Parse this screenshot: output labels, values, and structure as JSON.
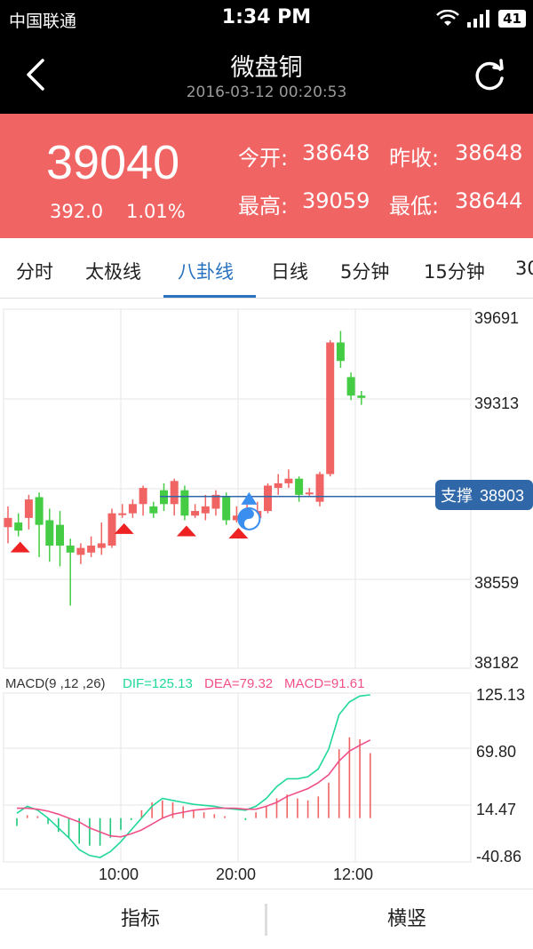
{
  "status": {
    "carrier": "中国联通",
    "time": "1:34 PM",
    "battery": "41"
  },
  "header": {
    "title": "微盘铜",
    "timestamp": "2016-03-12 00:20:53"
  },
  "quote": {
    "price": "39040",
    "change": "392.0",
    "change_pct": "1.01%",
    "open_label": "今开:",
    "open": "38648",
    "prev_close_label": "昨收:",
    "prev_close": "38648",
    "high_label": "最高:",
    "high": "39059",
    "low_label": "最低:",
    "low": "38644",
    "color": "#f06464"
  },
  "tabs": [
    {
      "label": "分时"
    },
    {
      "label": "太极线"
    },
    {
      "label": "八卦线",
      "active": true
    },
    {
      "label": "日线"
    },
    {
      "label": "5分钟"
    },
    {
      "label": "15分钟"
    },
    {
      "label": "30"
    }
  ],
  "chart_data": [
    {
      "type": "candlestick",
      "y_ticks": [
        "39691",
        "39313",
        "38559",
        "38182"
      ],
      "ylim": [
        38182,
        39691
      ],
      "support_label": "支撑",
      "support_value": "38903",
      "candles": [
        {
          "o": 38770,
          "c": 38810,
          "h": 38860,
          "l": 38700
        },
        {
          "o": 38790,
          "c": 38755,
          "h": 38830,
          "l": 38730
        },
        {
          "o": 38810,
          "c": 38890,
          "h": 38910,
          "l": 38760
        },
        {
          "o": 38900,
          "c": 38780,
          "h": 38920,
          "l": 38640
        },
        {
          "o": 38800,
          "c": 38690,
          "h": 38850,
          "l": 38620
        },
        {
          "o": 38780,
          "c": 38690,
          "h": 38840,
          "l": 38600
        },
        {
          "o": 38690,
          "c": 38660,
          "h": 38720,
          "l": 38430
        },
        {
          "o": 38650,
          "c": 38680,
          "h": 38700,
          "l": 38610
        },
        {
          "o": 38660,
          "c": 38690,
          "h": 38730,
          "l": 38640
        },
        {
          "o": 38680,
          "c": 38700,
          "h": 38790,
          "l": 38650
        },
        {
          "o": 38690,
          "c": 38830,
          "h": 38850,
          "l": 38680
        },
        {
          "o": 38830,
          "c": 38830,
          "h": 38870,
          "l": 38810
        },
        {
          "o": 38830,
          "c": 38870,
          "h": 38890,
          "l": 38810
        },
        {
          "o": 38870,
          "c": 38940,
          "h": 38950,
          "l": 38820
        },
        {
          "o": 38860,
          "c": 38830,
          "h": 38880,
          "l": 38810
        },
        {
          "o": 38930,
          "c": 38870,
          "h": 38960,
          "l": 38840
        },
        {
          "o": 38870,
          "c": 38970,
          "h": 38980,
          "l": 38820
        },
        {
          "o": 38930,
          "c": 38820,
          "h": 38950,
          "l": 38800
        },
        {
          "o": 38820,
          "c": 38840,
          "h": 38870,
          "l": 38810
        },
        {
          "o": 38830,
          "c": 38860,
          "h": 38910,
          "l": 38800
        },
        {
          "o": 38850,
          "c": 38910,
          "h": 38930,
          "l": 38820
        },
        {
          "o": 38900,
          "c": 38800,
          "h": 38920,
          "l": 38780
        },
        {
          "o": 38800,
          "c": 38820,
          "h": 38860,
          "l": 38790
        },
        {
          "o": 38800,
          "c": 38830,
          "h": 38880,
          "l": 38780
        },
        {
          "o": 38810,
          "c": 38840,
          "h": 38880,
          "l": 38790
        },
        {
          "o": 38840,
          "c": 38950,
          "h": 38960,
          "l": 38830
        },
        {
          "o": 38940,
          "c": 38960,
          "h": 39000,
          "l": 38910
        },
        {
          "o": 38960,
          "c": 38980,
          "h": 39020,
          "l": 38940
        },
        {
          "o": 38980,
          "c": 38910,
          "h": 38990,
          "l": 38880
        },
        {
          "o": 38920,
          "c": 38920,
          "h": 38940,
          "l": 38900
        },
        {
          "o": 38880,
          "c": 39000,
          "h": 39010,
          "l": 38860
        },
        {
          "o": 39000,
          "c": 39570,
          "h": 39580,
          "l": 38990
        },
        {
          "o": 39570,
          "c": 39490,
          "h": 39620,
          "l": 39460
        },
        {
          "o": 39420,
          "c": 39340,
          "h": 39440,
          "l": 39320
        },
        {
          "o": 39340,
          "c": 39330,
          "h": 39360,
          "l": 39300
        }
      ],
      "sell_markers": [
        1,
        11,
        17,
        22
      ],
      "buy_markers": [
        22
      ]
    },
    {
      "type": "line",
      "title": "MACD(9 ,12 ,26)",
      "dif_label": "DIF=125.13",
      "dea_label": "DEA=79.32",
      "macd_label": "MACD=91.61",
      "dif_color": "#1fd89a",
      "dea_color": "#f0508a",
      "y_ticks": [
        "125.13",
        "69.80",
        "14.47",
        "-40.86"
      ],
      "ylim": [
        -40.86,
        125.13
      ],
      "x_ticks": [
        "10:00",
        "20:00",
        "12:00"
      ],
      "dif": [
        5,
        12,
        8,
        0,
        -10,
        -20,
        -32,
        -38,
        -40,
        -34,
        -24,
        -12,
        0,
        12,
        20,
        18,
        16,
        14,
        13,
        12,
        10,
        9,
        8,
        12,
        20,
        32,
        40,
        40,
        42,
        50,
        70,
        105,
        118,
        124,
        125.13
      ],
      "dea": [
        10,
        10,
        9,
        7,
        4,
        0,
        -4,
        -10,
        -14,
        -18,
        -19,
        -16,
        -12,
        -6,
        0,
        4,
        6,
        8,
        9,
        10,
        10,
        10,
        9,
        9,
        12,
        16,
        22,
        26,
        30,
        36,
        44,
        58,
        68,
        74,
        79.32
      ],
      "macd": [
        -8,
        3,
        2,
        -6,
        -14,
        -20,
        -26,
        -28,
        -28,
        -20,
        -12,
        -2,
        8,
        16,
        18,
        16,
        12,
        8,
        6,
        4,
        2,
        0,
        -2,
        6,
        12,
        20,
        24,
        20,
        18,
        22,
        36,
        70,
        82,
        80,
        66
      ]
    }
  ],
  "bottom": {
    "indicator": "指标",
    "orientation": "横竖"
  }
}
